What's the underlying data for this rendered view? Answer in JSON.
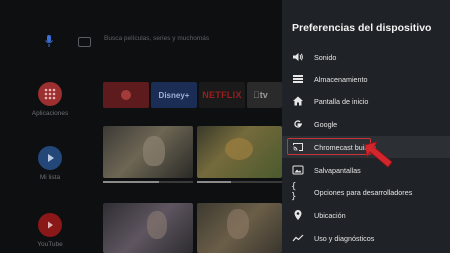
{
  "home": {
    "search_placeholder": "Busca películas, series y muchomás",
    "sidebar": [
      {
        "label": "Aplicaciones",
        "icon": "apps-grid-icon",
        "color": "#c83a3a"
      },
      {
        "label": "Mi lista",
        "icon": "play-icon",
        "color": "#2f5a9a"
      },
      {
        "label": "YouTube",
        "icon": "youtube-icon",
        "color": "#c21f1f"
      }
    ],
    "apps": [
      {
        "label": "",
        "icon": "red-app-icon"
      },
      {
        "label": "Disney+",
        "icon": "disney-plus-logo"
      },
      {
        "label": "NETFLIX",
        "icon": "netflix-logo"
      },
      {
        "label": "tv",
        "icon": "apple-tv-logo"
      }
    ]
  },
  "panel": {
    "title": "Preferencias del dispositivo",
    "items": [
      {
        "label": "Sonido",
        "icon": "speaker-icon"
      },
      {
        "label": "Almacenamiento",
        "icon": "storage-icon"
      },
      {
        "label": "Pantalla de inicio",
        "icon": "home-icon"
      },
      {
        "label": "Google",
        "icon": "google-icon"
      },
      {
        "label": "Chromecast built-in",
        "icon": "cast-icon"
      },
      {
        "label": "Salvapantallas",
        "icon": "screensaver-icon"
      },
      {
        "label": "Opciones para desarrolladores",
        "icon": "code-braces-icon"
      },
      {
        "label": "Ubicación",
        "icon": "location-pin-icon"
      },
      {
        "label": "Uso y diagnósticos",
        "icon": "trend-chart-icon"
      }
    ],
    "focused_item": "Chromecast built-in",
    "annotation_color": "#c8343a"
  }
}
